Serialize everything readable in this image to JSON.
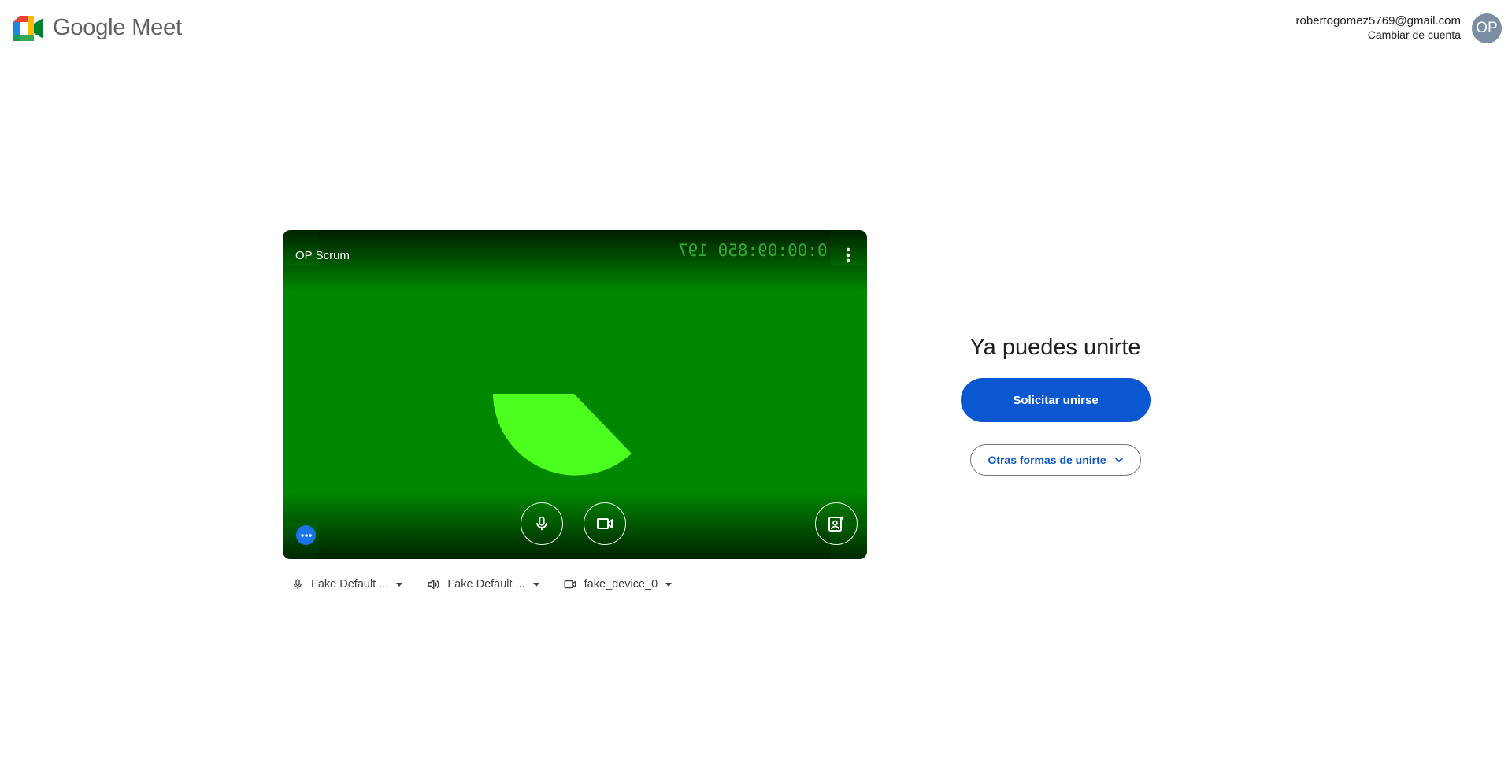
{
  "header": {
    "logo_text_brand": "Google",
    "logo_text_product": "Meet",
    "account_email": "robertogomez5769@gmail.com",
    "account_switch": "Cambiar de cuenta",
    "avatar_initials": "OP"
  },
  "preview": {
    "meeting_name": "OP Scrum",
    "timestamp": "0:00:09:850 197",
    "colors": {
      "background": "#008700",
      "shape": "#4cff1f"
    },
    "icons": [
      "more-vert-icon",
      "microphone-icon",
      "camera-icon",
      "visual-effects-icon",
      "more-options-icon"
    ]
  },
  "devices": [
    {
      "icon": "microphone-icon",
      "label": "Fake Default ..."
    },
    {
      "icon": "speaker-icon",
      "label": "Fake Default ..."
    },
    {
      "icon": "camera-icon",
      "label": "fake_device_0"
    }
  ],
  "join": {
    "title": "Ya puedes unirte",
    "request_button": "Solicitar unirse",
    "other_ways_button": "Otras formas de unirte",
    "accent_color": "#0b57d0"
  }
}
